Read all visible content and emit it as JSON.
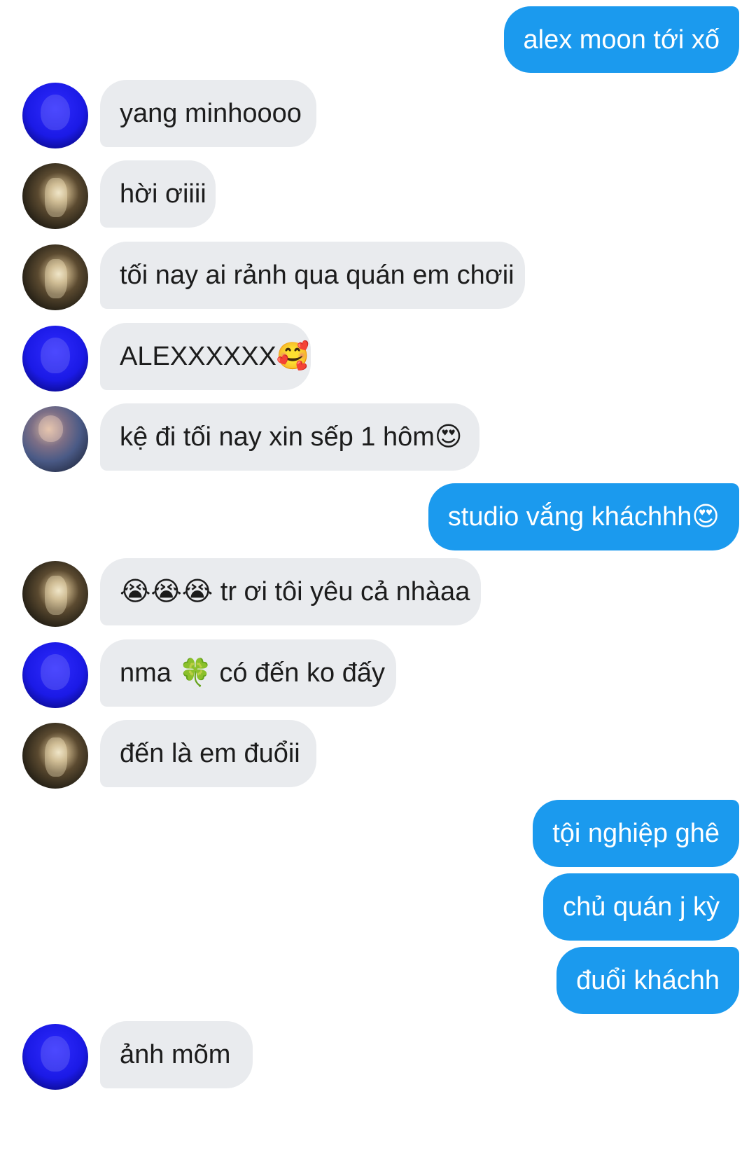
{
  "colors": {
    "outgoing_bubble": "#1b9aee",
    "incoming_bubble": "#e9ebee",
    "background": "#ffffff"
  },
  "messages": [
    {
      "side": "right",
      "text": "alex moon tới xố"
    },
    {
      "side": "left",
      "avatar": "blue-portrait-avatar",
      "text": "yang minhoooo"
    },
    {
      "side": "left",
      "avatar": "street-photo-avatar",
      "text": "hời ơiiii"
    },
    {
      "side": "left",
      "avatar": "street-photo-avatar",
      "text": "tối nay ai rảnh qua quán em chơii"
    },
    {
      "side": "left",
      "avatar": "blue-portrait-avatar",
      "text": "ALEXXXXXX🥰"
    },
    {
      "side": "left",
      "avatar": "guitar-player-avatar",
      "text": "kệ đi tối nay xin sếp 1 hôm😍"
    },
    {
      "side": "right",
      "text": "studio vắng kháchhh😍"
    },
    {
      "side": "left",
      "avatar": "street-photo-avatar",
      "text": "😭😭😭 tr ơi tôi yêu cả nhàaa"
    },
    {
      "side": "left",
      "avatar": "blue-portrait-avatar",
      "text": "nma 🍀 có đến ko đấy"
    },
    {
      "side": "left",
      "avatar": "street-photo-avatar",
      "text": "đến là em đuổii"
    },
    {
      "side": "right",
      "text": "tội nghiệp ghê"
    },
    {
      "side": "right",
      "text": "chủ quán j kỳ"
    },
    {
      "side": "right",
      "text": "đuổi kháchh"
    },
    {
      "side": "left",
      "avatar": "blue-portrait-avatar",
      "text": "ảnh mõm"
    }
  ]
}
